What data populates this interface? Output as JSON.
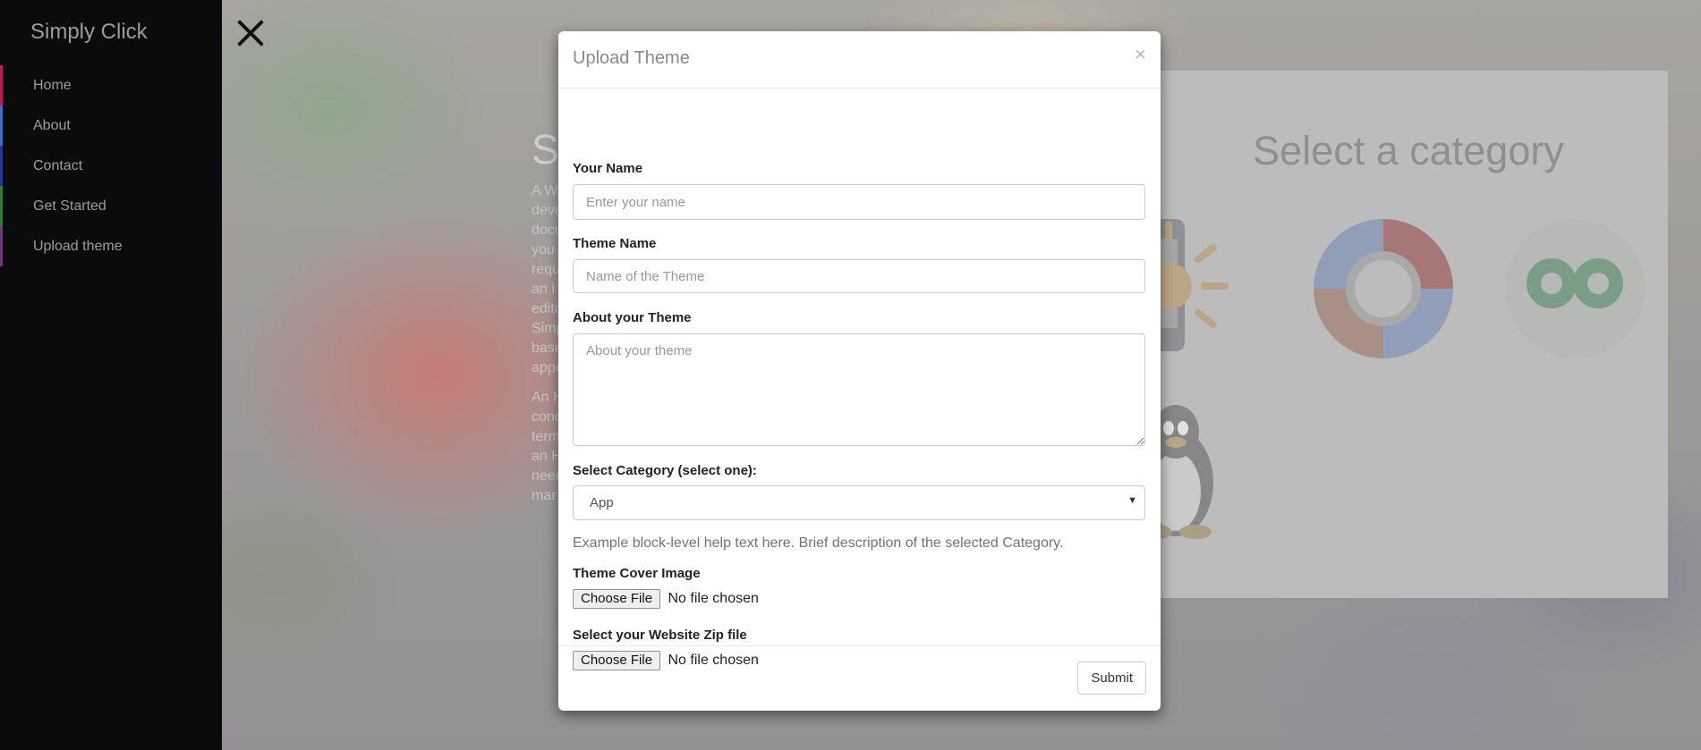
{
  "sidebar": {
    "brand": "Simply Click",
    "items": [
      {
        "label": "Home",
        "accent": "#c2185b"
      },
      {
        "label": "About",
        "accent": "#3f6fbf"
      },
      {
        "label": "Contact",
        "accent": "#283593"
      },
      {
        "label": "Get Started",
        "accent": "#2e7d32"
      },
      {
        "label": "Upload theme",
        "accent": "#6a3c7a"
      }
    ]
  },
  "background": {
    "section_title": "S",
    "para1": [
      "A W",
      "deve",
      "docu",
      "you",
      "requ",
      "an i",
      "edito",
      "Simp",
      "base",
      "appe"
    ],
    "para2": [
      "An H",
      "cond",
      "term",
      "an H",
      "need",
      "mar"
    ],
    "card_title": "Select a category"
  },
  "modal": {
    "title": "Upload Theme",
    "close_symbol": "×",
    "your_name_label": "Your Name",
    "your_name_placeholder": "Enter your name",
    "theme_name_label": "Theme Name",
    "theme_name_placeholder": "Name of the Theme",
    "about_label": "About your Theme",
    "about_placeholder": "About your theme",
    "category_label": "Select Category (select one):",
    "category_value": "App",
    "category_caret": "▼",
    "help_text": "Example block-level help text here. Brief description of the selected Category.",
    "cover_label": "Theme Cover Image",
    "zip_label": "Select your Website Zip file",
    "file_button": "Choose File",
    "file_status": "No file chosen",
    "submit": "Submit"
  }
}
